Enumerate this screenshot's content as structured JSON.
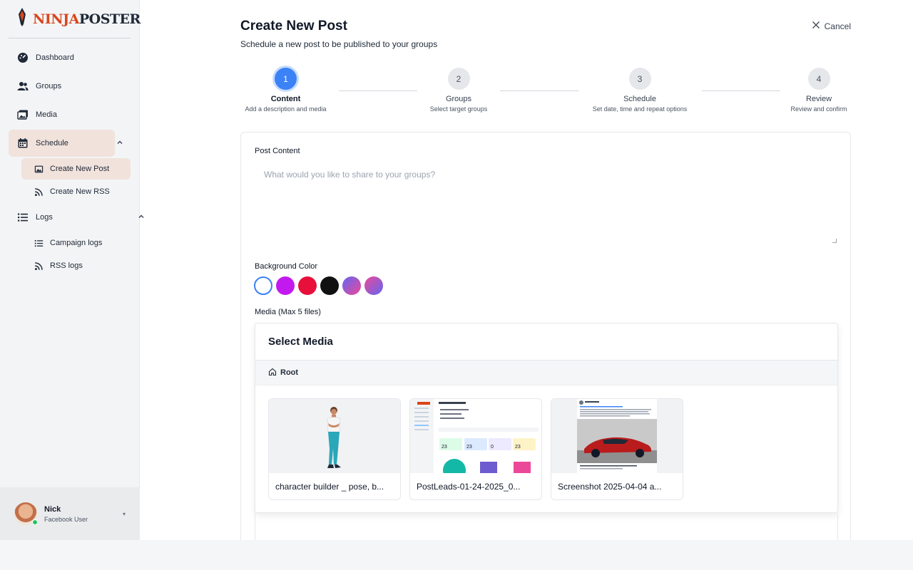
{
  "brand": {
    "logo_part1": "NINJA",
    "logo_part2": "POSTER"
  },
  "sidebar": {
    "items": [
      {
        "label": "Dashboard",
        "icon": "dashboard-icon"
      },
      {
        "label": "Groups",
        "icon": "users-icon"
      },
      {
        "label": "Media",
        "icon": "images-icon"
      },
      {
        "label": "Schedule",
        "icon": "calendar-icon",
        "expanded": true
      },
      {
        "label": "Logs",
        "icon": "list-icon",
        "expanded": true
      }
    ],
    "schedule_sub": [
      {
        "label": "Create New Post",
        "icon": "image-icon",
        "active": true
      },
      {
        "label": "Create New RSS",
        "icon": "rss-icon"
      }
    ],
    "logs_sub": [
      {
        "label": "Campaign logs",
        "icon": "list-icon"
      },
      {
        "label": "RSS logs",
        "icon": "rss-icon"
      }
    ]
  },
  "user": {
    "name": "Nick",
    "role": "Facebook User",
    "status": "online"
  },
  "header": {
    "title": "Create New Post",
    "subtitle": "Schedule a new post to be published to your groups",
    "cancel_label": "Cancel"
  },
  "steps": [
    {
      "num": "1",
      "label": "Content",
      "desc": "Add a description and media",
      "active": true
    },
    {
      "num": "2",
      "label": "Groups",
      "desc": "Select target groups"
    },
    {
      "num": "3",
      "label": "Schedule",
      "desc": "Set date, time and repeat options"
    },
    {
      "num": "4",
      "label": "Review",
      "desc": "Review and confirm"
    }
  ],
  "form": {
    "content_label": "Post Content",
    "content_placeholder": "What would you like to share to your groups?",
    "content_value": "",
    "bg_label": "Background Color",
    "colors": [
      "#ffffff",
      "#c21aee",
      "#e8103b",
      "#111111",
      "linear-gradient(135deg,#6366f1,#ec4899)",
      "linear-gradient(135deg,#ec4899,#6366f1)"
    ],
    "selected_color_index": 0,
    "media_label": "Media (Max 5 files)"
  },
  "media": {
    "title": "Select Media",
    "breadcrumb": "Root",
    "files": [
      {
        "name": "character builder _ pose, b..."
      },
      {
        "name": "PostLeads-01-24-2025_0..."
      },
      {
        "name": "Screenshot 2025-04-04 a..."
      }
    ]
  }
}
